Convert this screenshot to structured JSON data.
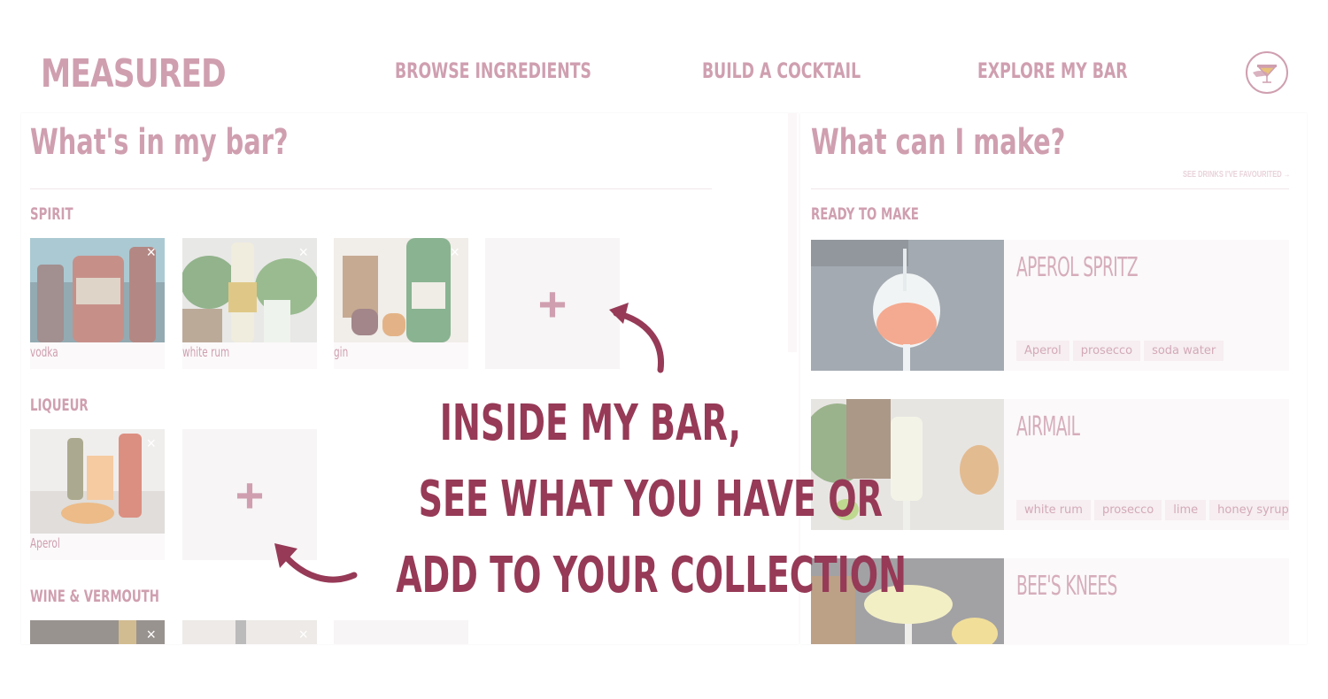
{
  "app": {
    "logo": "MEASURED"
  },
  "nav": {
    "items": [
      "BROWSE INGREDIENTS",
      "BUILD A COCKTAIL",
      "EXPLORE MY BAR"
    ]
  },
  "left": {
    "title": "What's in my bar?",
    "groups": [
      {
        "label": "SPIRIT",
        "items": [
          "vodka",
          "white rum",
          "gin"
        ]
      },
      {
        "label": "LIQUEUR",
        "items": [
          "Aperol"
        ]
      },
      {
        "label": "WINE & VERMOUTH",
        "items": []
      }
    ],
    "remove_glyph": "×",
    "add_glyph": "+"
  },
  "right": {
    "title": "What can I make?",
    "favourites_link": "SEE DRINKS I'VE FAVOURITED →",
    "ready_label": "READY TO MAKE",
    "drinks": [
      {
        "name": "APEROL SPRITZ",
        "tags": [
          "Aperol",
          "prosecco",
          "soda water"
        ]
      },
      {
        "name": "AIRMAIL",
        "tags": [
          "white rum",
          "prosecco",
          "lime",
          "honey syrup"
        ]
      },
      {
        "name": "BEE'S KNEES",
        "tags": []
      }
    ]
  },
  "overlay": {
    "lines": [
      "INSIDE MY BAR,",
      "SEE WHAT YOU HAVE OR",
      "ADD TO YOUR COLLECTION"
    ]
  },
  "colors": {
    "brand": "#cf9fb0",
    "accent": "#963a57"
  }
}
